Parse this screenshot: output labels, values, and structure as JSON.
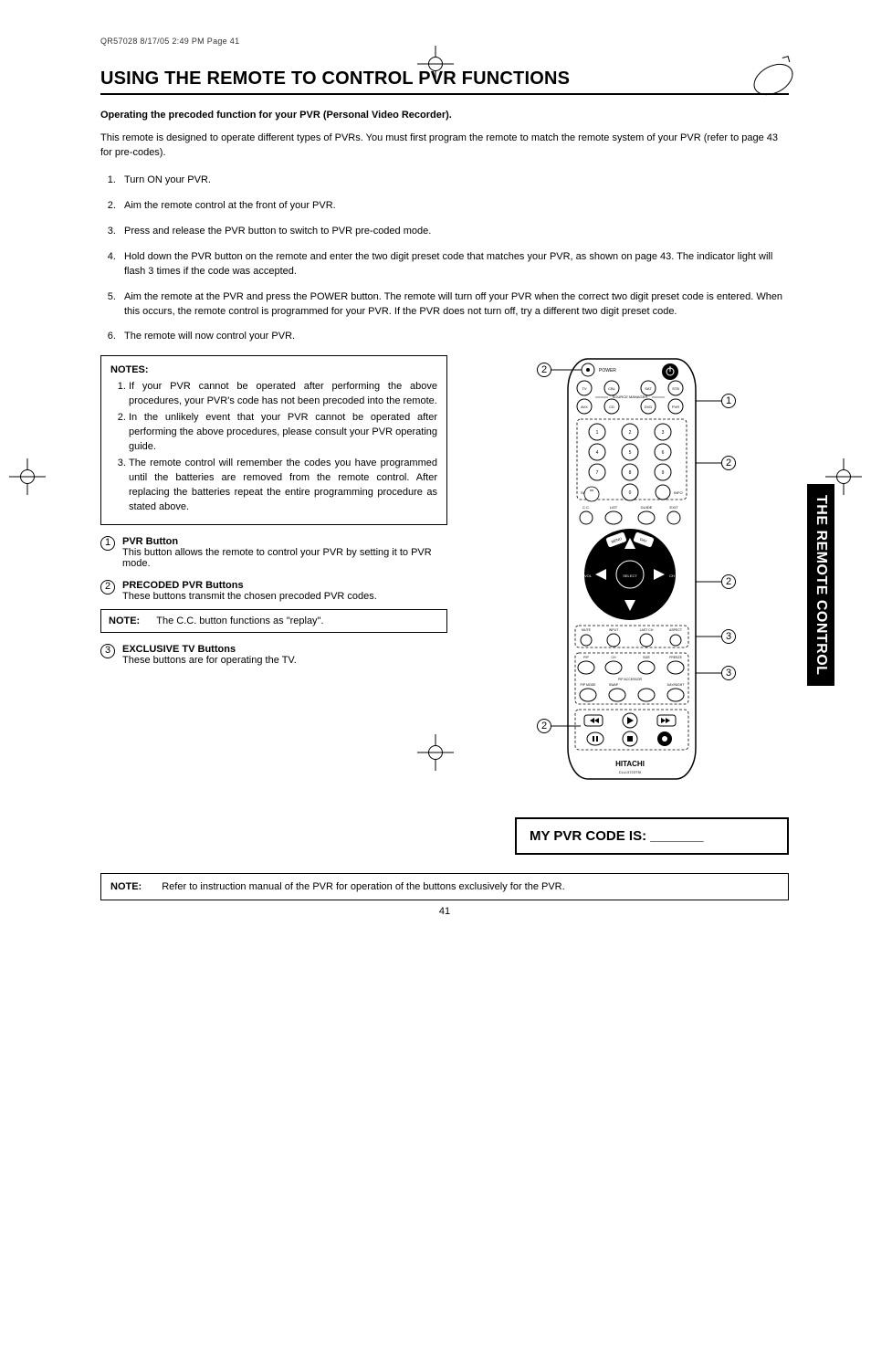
{
  "header_line": "QR57028  8/17/05  2:49 PM  Page 41",
  "title": "USING THE REMOTE TO CONTROL PVR FUNCTIONS",
  "remote_icon_label": "",
  "intro_bold": "Operating the precoded function for your PVR (Personal Video Recorder).",
  "intro": "This remote is designed to operate different types of PVRs.  You must first program the remote to match the remote system of your PVR (refer to page 43 for pre-codes).",
  "steps": [
    "Turn ON your PVR.",
    "Aim the remote control at the front of your PVR.",
    "Press and release the PVR button to switch to PVR pre-coded mode.",
    "Hold down the PVR button on the remote and enter the two digit preset code that matches your PVR, as shown on page 43.  The indicator light will flash 3 times if the code was accepted.",
    "Aim the remote at the PVR and press the POWER button.  The remote will turn off your PVR when the correct two digit preset code is entered.  When this occurs, the remote control is programmed for your PVR.  If the PVR does not turn off, try a different two digit preset code.",
    "The remote will now control your PVR."
  ],
  "notes_title": "NOTES:",
  "notes": [
    "If your PVR cannot be operated after performing the above procedures, your PVR's code has not been precoded into the remote.",
    "In the unlikely event that your PVR cannot be operated after performing the above procedures, please consult your PVR operating guide.",
    "The remote control will remember the codes you have programmed until the batteries are removed from the remote control.  After replacing the batteries repeat the entire programming procedure as stated above."
  ],
  "sections": [
    {
      "num": "1",
      "bold": "PVR Button",
      "text": "This button allows the remote to control your PVR by setting it to PVR mode."
    },
    {
      "num": "2",
      "bold": "PRECODED PVR Buttons",
      "text": "These buttons transmit the chosen precoded PVR codes."
    }
  ],
  "small_note_label": "NOTE:",
  "small_note_text": "The C.C. button functions as \"replay\".",
  "section3": {
    "num": "3",
    "bold": "EXCLUSIVE TV Buttons",
    "text": "These buttons are for operating the TV."
  },
  "side_tab": "THE REMOTE CONTROL",
  "code_box": "MY PVR CODE IS: _______",
  "bottom_note_label": "NOTE:",
  "bottom_note_text": "Refer to instruction manual of the PVR for operation of the buttons exclusively for the PVR.",
  "page_number": "41",
  "remote": {
    "brand": "HITACHI",
    "model": "CLU-5723TSI",
    "top_labels": {
      "power": "POWER"
    },
    "row1": [
      "TV",
      "CBL",
      "SAT",
      "STB"
    ],
    "source_label": "SOURCE MANAGER",
    "row2": [
      "AVX",
      "CD",
      "DVD",
      "PVR"
    ],
    "numpad": [
      "1",
      "2",
      "3",
      "4",
      "5",
      "6",
      "7",
      "8",
      "9",
      "0"
    ],
    "sleep": "SLEEP",
    "info": "INFO",
    "cc_row": [
      "C.C.",
      "LIST",
      "GUIDE",
      "EXIT"
    ],
    "cursor": {
      "menu": "MENU",
      "day": "DAY",
      "select": "SELECT",
      "vol": "VOL",
      "ch": "CH"
    },
    "mute_row": [
      "MUTE",
      "INPUT",
      "LAST CH",
      "ASPECT"
    ],
    "pip_row1": [
      "PIP",
      "CH",
      "SIZE",
      "FREEZE"
    ],
    "pip_access": "PIP ACCESSOR",
    "pip_row2": [
      "PIP MODE",
      "SWAP",
      "",
      "DAY/NIGHT"
    ],
    "transport": [
      "REW",
      "PLAY",
      "FF",
      "PAUSE",
      "STOP",
      "REC"
    ]
  }
}
